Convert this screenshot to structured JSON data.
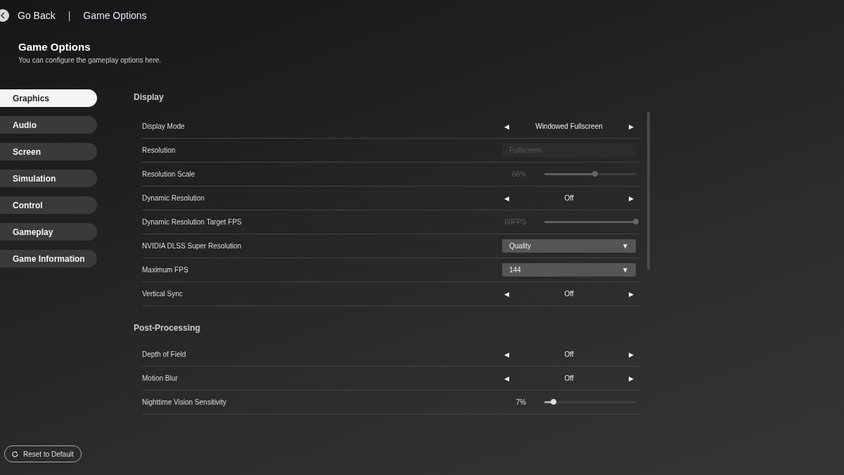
{
  "header": {
    "back_label": "Go Back",
    "separator": "|",
    "breadcrumb": "Game Options"
  },
  "page": {
    "title": "Game Options",
    "subtitle": "You can configure the gameplay options here."
  },
  "tabs": [
    {
      "label": "Graphics",
      "selected": true
    },
    {
      "label": "Audio",
      "selected": false
    },
    {
      "label": "Screen",
      "selected": false
    },
    {
      "label": "Simulation",
      "selected": false
    },
    {
      "label": "Control",
      "selected": false
    },
    {
      "label": "Gameplay",
      "selected": false
    },
    {
      "label": "Game Information",
      "selected": false
    }
  ],
  "sections": [
    {
      "title": "Display",
      "settings": [
        {
          "kind": "selector",
          "label": "Display Mode",
          "value": "Windowed Fullscreen",
          "prev": "◀",
          "next": "▶",
          "disabled": false
        },
        {
          "kind": "dropdown",
          "label": "Resolution",
          "value": "Fullscreen",
          "disabled": true
        },
        {
          "kind": "slider",
          "label": "Resolution Scale",
          "reading": "66%",
          "level": 0.55,
          "disabled": true
        },
        {
          "kind": "selector",
          "label": "Dynamic Resolution",
          "value": "Off",
          "prev": "◀",
          "next": "▶",
          "disabled": false
        },
        {
          "kind": "slider",
          "label": "Dynamic Resolution Target FPS",
          "reading": "60FPS",
          "level": 1,
          "disabled": true
        },
        {
          "kind": "dropdown",
          "label": "NVIDIA DLSS Super Resolution",
          "value": "Quality",
          "caret": "▼",
          "disabled": false
        },
        {
          "kind": "dropdown",
          "label": "Maximum FPS",
          "value": "144",
          "caret": "▼",
          "disabled": false
        },
        {
          "kind": "selector",
          "label": "Vertical Sync",
          "value": "Off",
          "prev": "◀",
          "next": "▶",
          "disabled": false
        }
      ]
    },
    {
      "title": "Post-Processing",
      "settings": [
        {
          "kind": "selector",
          "label": "Depth of Field",
          "value": "Off",
          "prev": "◀",
          "next": "▶",
          "disabled": false
        },
        {
          "kind": "selector",
          "label": "Motion Blur",
          "value": "Off",
          "prev": "◀",
          "next": "▶",
          "disabled": false
        },
        {
          "kind": "slider",
          "label": "Nighttime Vision Sensitivity",
          "reading": "7%",
          "level": 0.1,
          "disabled": false
        }
      ]
    }
  ],
  "reset_button": {
    "label": "Reset to Default"
  }
}
